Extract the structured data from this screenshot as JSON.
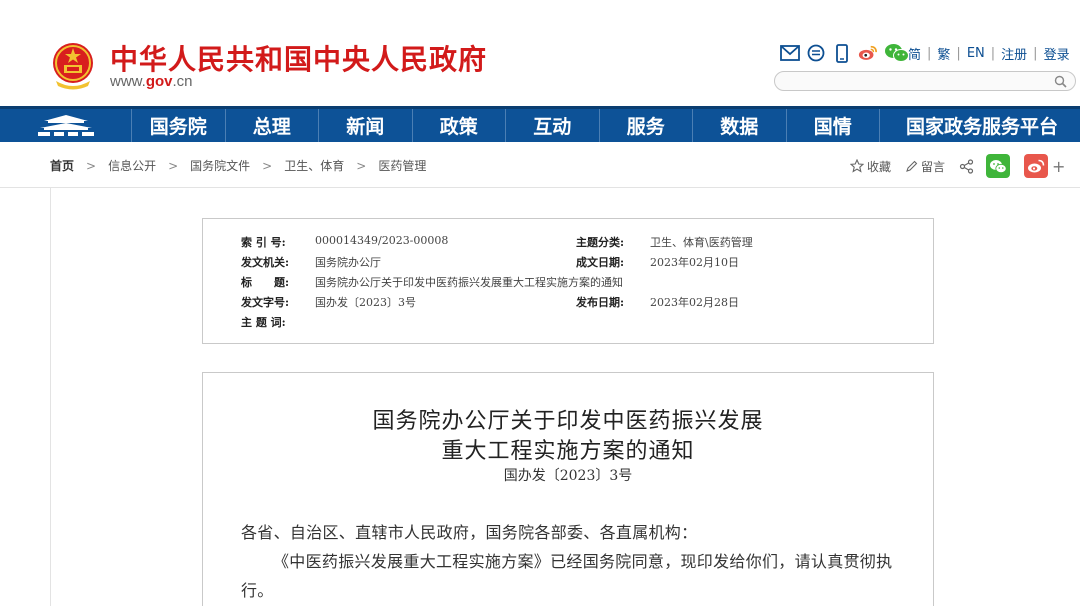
{
  "header": {
    "site_title": "中华人民共和国中央人民政府",
    "url_prefix": "www.",
    "url_gov": "gov",
    "url_suffix": ".cn",
    "icons": [
      "mail-icon",
      "chat-bubble-icon",
      "mobile-icon",
      "weibo-icon",
      "wechat-icon"
    ],
    "links": {
      "simplified": "简",
      "traditional": "繁",
      "english": "EN",
      "register": "注册",
      "login": "登录"
    },
    "search_placeholder": ""
  },
  "nav": {
    "items": [
      "国务院",
      "总理",
      "新闻",
      "政策",
      "互动",
      "服务",
      "数据",
      "国情",
      "国家政务服务平台"
    ]
  },
  "breadcrumb": {
    "items": [
      "首页",
      "信息公开",
      "国务院文件",
      "卫生、体育",
      "医药管理"
    ]
  },
  "share": {
    "favorite": "收藏",
    "comment": "留言",
    "plus": "+"
  },
  "meta": {
    "index_label": "索 引 号:",
    "index_value": "000014349/2023-00008",
    "category_label": "主题分类:",
    "category_value": "卫生、体育\\医药管理",
    "issuer_label": "发文机关:",
    "issuer_value": "国务院办公厅",
    "created_label": "成文日期:",
    "created_value": "2023年02月10日",
    "title_label": "标　　题:",
    "title_value": "国务院办公厅关于印发中医药振兴发展重大工程实施方案的通知",
    "docno_label": "发文字号:",
    "docno_value": "国办发〔2023〕3号",
    "published_label": "发布日期:",
    "published_value": "2023年02月28日",
    "keywords_label": "主 题 词:",
    "keywords_value": ""
  },
  "document": {
    "title_line1": "国务院办公厅关于印发中医药振兴发展",
    "title_line2": "重大工程实施方案的通知",
    "doc_number": "国办发〔2023〕3号",
    "salutation": "各省、自治区、直辖市人民政府，国务院各部委、各直属机构：",
    "body_line1": "《中医药振兴发展重大工程实施方案》已经国务院同意，现印发给你们，请认真贯彻执",
    "body_line2": "行。"
  },
  "colors": {
    "brand_red": "#d21a1a",
    "nav_blue": "#0d5297",
    "link_blue": "#0d4f92",
    "wechat_green": "#3fb53a",
    "weibo_red": "#e8574c"
  }
}
